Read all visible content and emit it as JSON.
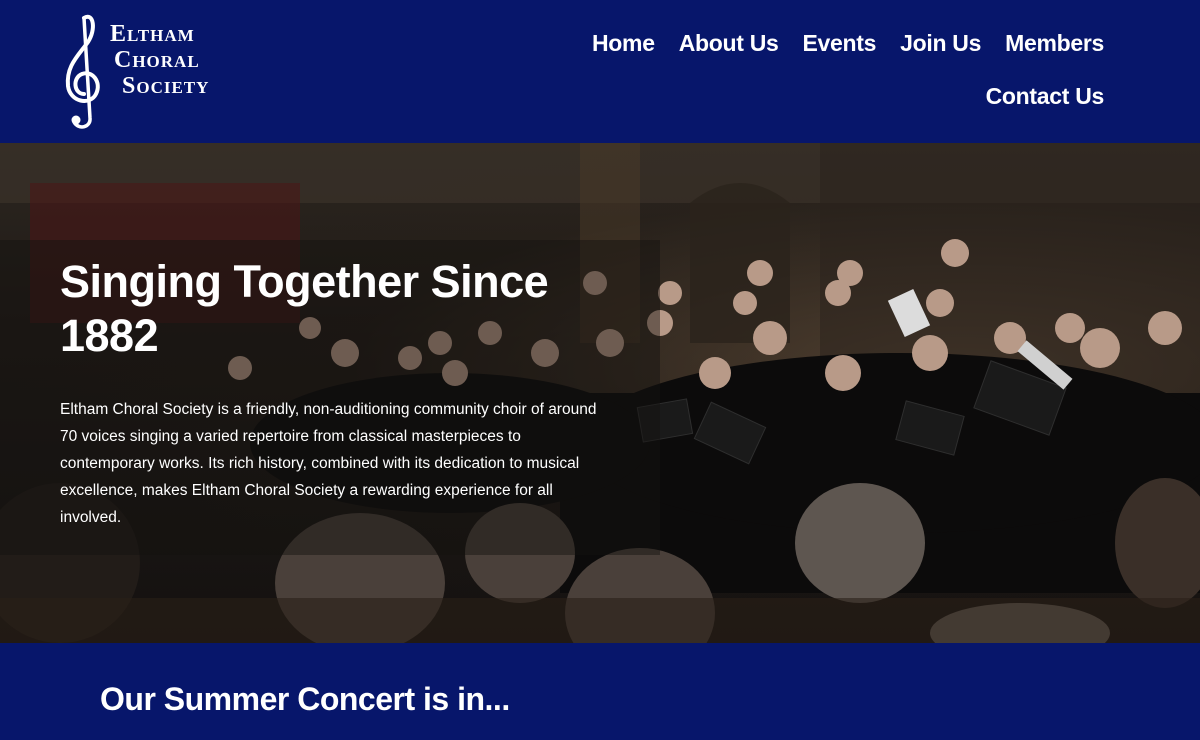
{
  "logo": {
    "line1": "Eltham",
    "line2": "Choral",
    "line3": "Society"
  },
  "nav": {
    "items": [
      {
        "label": "Home"
      },
      {
        "label": "About Us"
      },
      {
        "label": "Events"
      },
      {
        "label": "Join Us"
      },
      {
        "label": "Members"
      },
      {
        "label": "Contact Us"
      }
    ]
  },
  "hero": {
    "title": "Singing Together Since 1882",
    "body": "Eltham Choral Society is a friendly, non-auditioning community choir of around 70 voices singing a varied repertoire from classical masterpieces to contemporary works. Its rich history, combined with its dedication to musical excellence, makes Eltham Choral Society a rewarding experience for all involved."
  },
  "band": {
    "heading": "Our Summer Concert is in..."
  },
  "colors": {
    "header_bg": "#07166b",
    "text": "#ffffff"
  }
}
